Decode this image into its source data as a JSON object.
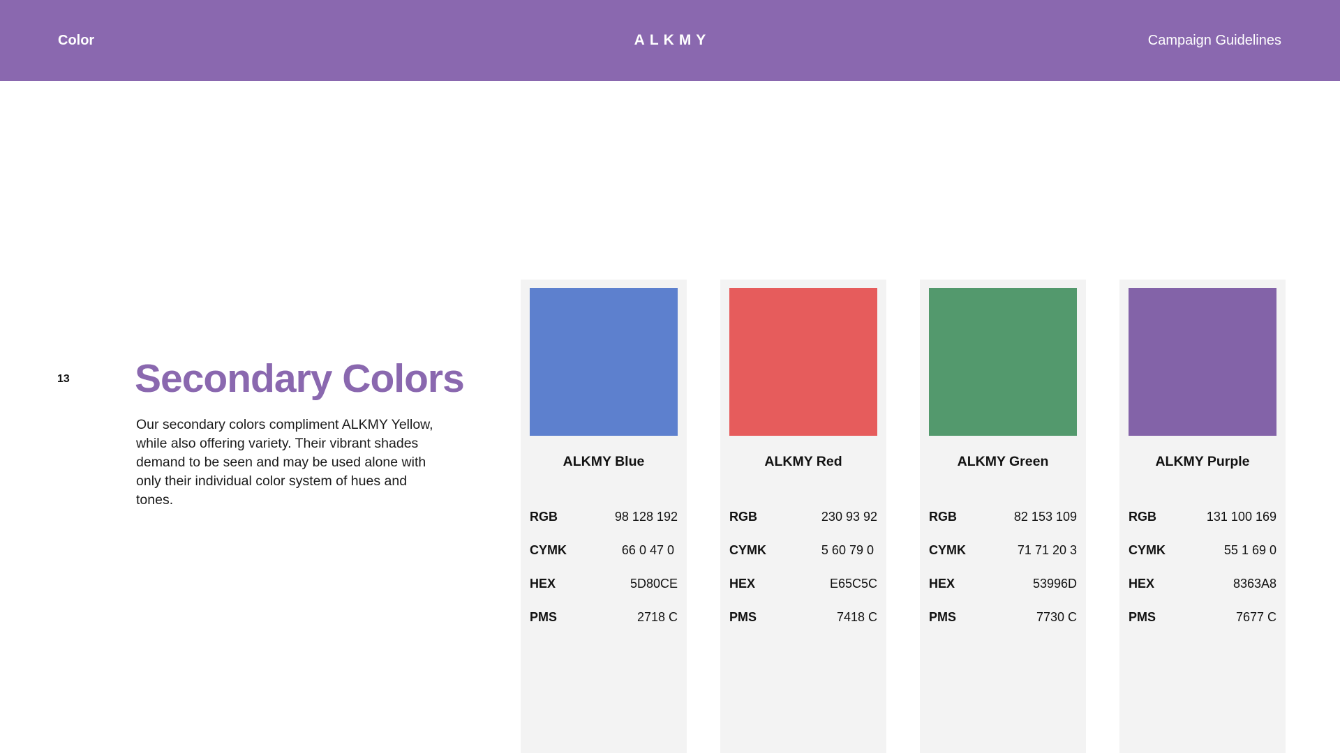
{
  "header": {
    "section": "Color",
    "logo": "ALKMY",
    "document": "Campaign Guidelines",
    "background_color": "#8A68AF"
  },
  "page": {
    "number": "13",
    "title": "Secondary Colors",
    "description": "Our secondary colors compliment ALKMY Yellow, while also offering variety. Their vibrant shades demand to be seen and may be used alone with only their individual color system of hues and tones."
  },
  "labels": {
    "rgb": "RGB",
    "cmyk": "CYMK",
    "hex": "HEX",
    "pms": "PMS"
  },
  "colors": [
    {
      "name": "ALKMY Blue",
      "swatch": "#5D80CE",
      "rgb": "98 128 192",
      "cmyk": "66 0 47 0",
      "hex": "5D80CE",
      "pms": "2718 C"
    },
    {
      "name": "ALKMY Red",
      "swatch": "#E65C5C",
      "rgb": "230 93 92",
      "cmyk": "5 60 79 0",
      "hex": "E65C5C",
      "pms": "7418 C"
    },
    {
      "name": "ALKMY Green",
      "swatch": "#53996D",
      "rgb": "82 153 109",
      "cmyk": "71 71 20 3",
      "hex": "53996D",
      "pms": "7730 C"
    },
    {
      "name": "ALKMY Purple",
      "swatch": "#8363A8",
      "rgb": "131 100 169",
      "cmyk": "55 1 69 0",
      "hex": "8363A8",
      "pms": "7677 C"
    }
  ]
}
